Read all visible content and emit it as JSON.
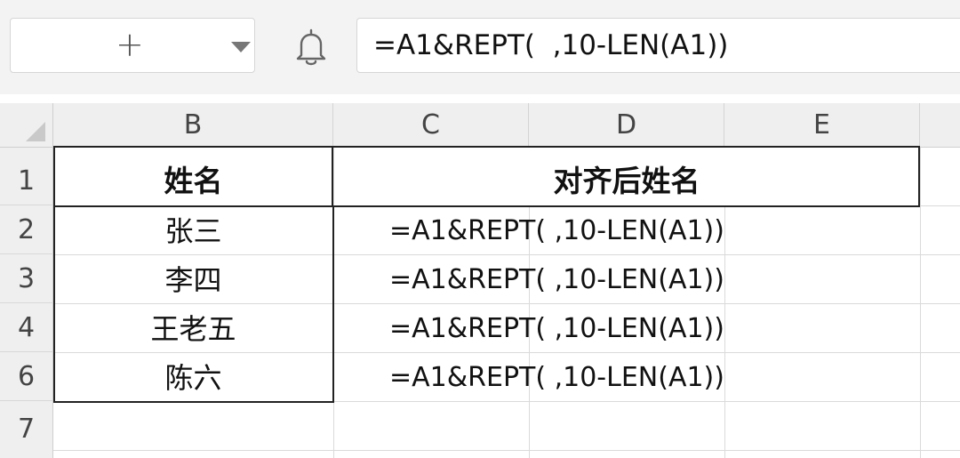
{
  "name_box": {
    "icon": "plus-icon",
    "dropdown_icon": "caret-down-icon"
  },
  "notify_icon": "bell-icon",
  "formula_bar": {
    "text": "=A1&REPT(  ,10-LEN(A1))"
  },
  "columns": [
    "B",
    "C",
    "D",
    "E"
  ],
  "rows": [
    "1",
    "2",
    "3",
    "4",
    "6",
    "7"
  ],
  "table": {
    "header": {
      "name": "姓名",
      "aligned": "对齐后姓名"
    },
    "names": [
      "张三",
      "李四",
      "王老五",
      "陈六"
    ],
    "formulas": [
      "=A1&REPT( ,10-LEN(A1))",
      "=A1&REPT( ,10-LEN(A1))",
      "=A1&REPT( ,10-LEN(A1))",
      "=A1&REPT( ,10-LEN(A1))"
    ]
  }
}
